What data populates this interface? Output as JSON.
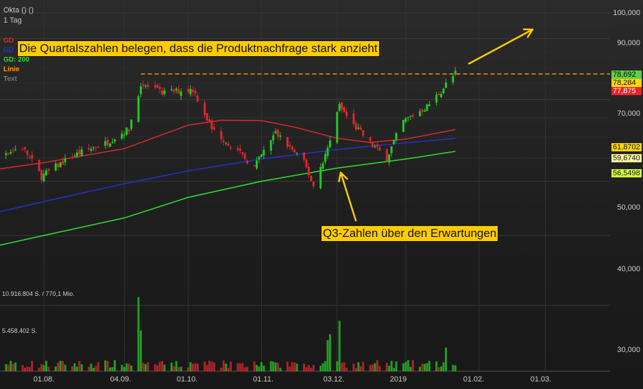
{
  "chart_data": {
    "type": "candlestick",
    "title": "Okta () ()",
    "interval": "1 Tag",
    "y_scale": "log",
    "ylim": [
      28000,
      108000
    ],
    "grid": true,
    "legend_position": "top-left",
    "colors": {
      "up": "#26c926",
      "down": "#e0262c",
      "gd_red": "#d42a2a",
      "gd_blue": "#2430c8",
      "gd_200": "#2fd82f",
      "line": "#ff9900",
      "callout": "#ffcc00"
    },
    "legend": [
      {
        "label": "GD",
        "color": "#d42a2a"
      },
      {
        "label": "GD",
        "color": "#2430c8"
      },
      {
        "label": "GD: 200",
        "color": "#2fd82f"
      },
      {
        "label": "Linie",
        "color": "#ff9900"
      },
      {
        "label": "Text",
        "color": "#7a7a7a"
      }
    ],
    "annotations": [
      {
        "text": "Die Quartalszahlen belegen, dass die Produktnachfrage stark anzieht"
      },
      {
        "text": "Q3-Zahlen über den Erwartungen"
      }
    ],
    "horizontal_line": {
      "value": 77800,
      "color": "#ff9900",
      "style": "dashed",
      "from_date": "2018-09-11"
    },
    "y_ticks": [
      "100,000",
      "90,000",
      "70,000",
      "50,000",
      "40,000",
      "30,000"
    ],
    "y_tick_values": [
      100000,
      90000,
      70000,
      50000,
      40000,
      30000
    ],
    "price_tags": [
      {
        "text": "78,692",
        "value": 78692
      },
      {
        "text": "78,284",
        "value": 78284
      },
      {
        "text": "77,875",
        "value": 77875
      },
      {
        "text": "61,8702",
        "value": 61870
      },
      {
        "text": "59,6740",
        "value": 59674
      },
      {
        "text": "56,5498",
        "value": 56550
      }
    ],
    "volume_labels": [
      "10.916.804 S. / 770,1 Mio.",
      "5.458.402 S."
    ],
    "volume_max": 10916804,
    "x_ticks": [
      {
        "label": "01.08.",
        "date": "2018-08-01"
      },
      {
        "label": "04.09.",
        "date": "2018-09-04"
      },
      {
        "label": "01.10.",
        "date": "2018-10-01"
      },
      {
        "label": "01.11.",
        "date": "2018-11-01"
      },
      {
        "label": "03.12.",
        "date": "2018-12-03"
      },
      {
        "label": "2019",
        "date": "2019-01-01"
      },
      {
        "label": "01.02.",
        "date": "2019-02-01"
      },
      {
        "label": "01.03.",
        "date": "2019-03-01"
      }
    ],
    "close_keypoints": [
      [
        "2018-07-09",
        55200
      ],
      [
        "2018-07-23",
        57500
      ],
      [
        "2018-07-31",
        51000
      ],
      [
        "2018-08-13",
        55500
      ],
      [
        "2018-08-27",
        58500
      ],
      [
        "2018-09-06",
        62000
      ],
      [
        "2018-09-11",
        74500
      ],
      [
        "2018-09-20",
        72000
      ],
      [
        "2018-10-03",
        73000
      ],
      [
        "2018-10-11",
        62000
      ],
      [
        "2018-10-19",
        58000
      ],
      [
        "2018-10-29",
        53000
      ],
      [
        "2018-11-07",
        61000
      ],
      [
        "2018-11-19",
        54000
      ],
      [
        "2018-11-23",
        49000
      ],
      [
        "2018-11-30",
        58500
      ],
      [
        "2018-12-04",
        68000
      ],
      [
        "2018-12-10",
        63000
      ],
      [
        "2018-12-17",
        58500
      ],
      [
        "2018-12-24",
        55000
      ],
      [
        "2018-12-31",
        64000
      ],
      [
        "2019-01-10",
        68000
      ],
      [
        "2019-01-16",
        72500
      ],
      [
        "2019-01-22",
        78692
      ]
    ],
    "gd_red": [
      [
        "2018-07-02",
        51800
      ],
      [
        "2018-08-01",
        54000
      ],
      [
        "2018-09-04",
        57200
      ],
      [
        "2018-10-01",
        63000
      ],
      [
        "2018-10-15",
        64300
      ],
      [
        "2018-11-01",
        64200
      ],
      [
        "2018-11-15",
        62500
      ],
      [
        "2018-12-03",
        59700
      ],
      [
        "2018-12-17",
        58700
      ],
      [
        "2019-01-01",
        59500
      ],
      [
        "2019-01-22",
        61870
      ]
    ],
    "gd_blue": [
      [
        "2018-07-02",
        43000
      ],
      [
        "2018-08-01",
        46000
      ],
      [
        "2018-09-04",
        49500
      ],
      [
        "2018-10-01",
        52200
      ],
      [
        "2018-11-01",
        54800
      ],
      [
        "2018-12-03",
        57000
      ],
      [
        "2019-01-01",
        58600
      ],
      [
        "2019-01-22",
        59674
      ]
    ],
    "gd_200": [
      [
        "2018-07-02",
        37500
      ],
      [
        "2018-08-01",
        40000
      ],
      [
        "2018-09-04",
        43000
      ],
      [
        "2018-10-01",
        46800
      ],
      [
        "2018-11-01",
        50000
      ],
      [
        "2018-12-03",
        52800
      ],
      [
        "2019-01-01",
        54800
      ],
      [
        "2019-01-22",
        56550
      ]
    ]
  }
}
